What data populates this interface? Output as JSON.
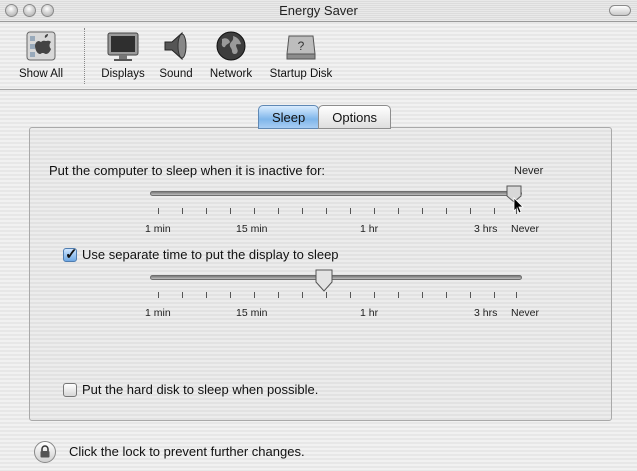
{
  "window": {
    "title": "Energy Saver"
  },
  "toolbar": {
    "items": [
      {
        "label": "Show All",
        "icon": "apple-show-all-icon"
      },
      {
        "label": "Displays",
        "icon": "display-monitor-icon"
      },
      {
        "label": "Sound",
        "icon": "speaker-icon"
      },
      {
        "label": "Network",
        "icon": "globe-icon"
      },
      {
        "label": "Startup Disk",
        "icon": "hard-disk-icon"
      }
    ]
  },
  "tabs": [
    {
      "label": "Sleep",
      "selected": true
    },
    {
      "label": "Options",
      "selected": false
    }
  ],
  "computer_sleep": {
    "label": "Put the computer to sleep when it is inactive for:",
    "value": "Never",
    "slider_position": 1.0
  },
  "slider_labels": {
    "min1": "1 min",
    "min15": "15 min",
    "hr1": "1 hr",
    "hrs3": "3 hrs",
    "never": "Never"
  },
  "display_sleep": {
    "label": "Use separate time to put the display to sleep",
    "checked": true,
    "slider_position": 0.47
  },
  "hard_disk": {
    "label": "Put the hard disk to sleep when possible.",
    "checked": false
  },
  "lock": {
    "label": "Click the lock to prevent further changes."
  }
}
